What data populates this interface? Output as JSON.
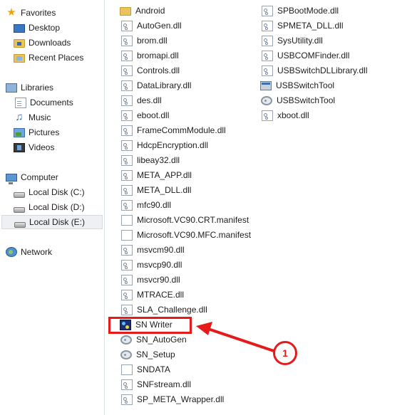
{
  "navigation": {
    "favorites": {
      "label": "Favorites",
      "icon": "star-icon",
      "items": [
        {
          "label": "Desktop",
          "icon": "desktop-icon"
        },
        {
          "label": "Downloads",
          "icon": "downloads-folder-icon"
        },
        {
          "label": "Recent Places",
          "icon": "recent-places-icon"
        }
      ]
    },
    "libraries": {
      "label": "Libraries",
      "icon": "libraries-icon",
      "items": [
        {
          "label": "Documents",
          "icon": "documents-icon"
        },
        {
          "label": "Music",
          "icon": "music-icon"
        },
        {
          "label": "Pictures",
          "icon": "pictures-icon"
        },
        {
          "label": "Videos",
          "icon": "videos-icon"
        }
      ]
    },
    "computer": {
      "label": "Computer",
      "icon": "computer-icon",
      "items": [
        {
          "label": "Local Disk (C:)",
          "icon": "disk-icon"
        },
        {
          "label": "Local Disk (D:)",
          "icon": "disk-icon"
        },
        {
          "label": "Local Disk (E:)",
          "icon": "disk-icon",
          "selected": true
        }
      ]
    },
    "network": {
      "label": "Network",
      "icon": "network-icon"
    }
  },
  "files": {
    "column1": [
      {
        "name": "Android",
        "type": "folder"
      },
      {
        "name": "AutoGen.dll",
        "type": "dll"
      },
      {
        "name": "brom.dll",
        "type": "dll"
      },
      {
        "name": "bromapi.dll",
        "type": "dll"
      },
      {
        "name": "Controls.dll",
        "type": "dll"
      },
      {
        "name": "DataLibrary.dll",
        "type": "dll"
      },
      {
        "name": "des.dll",
        "type": "dll"
      },
      {
        "name": "eboot.dll",
        "type": "dll"
      },
      {
        "name": "FrameCommModule.dll",
        "type": "dll"
      },
      {
        "name": "HdcpEncryption.dll",
        "type": "dll"
      },
      {
        "name": "libeay32.dll",
        "type": "dll"
      },
      {
        "name": "META_APP.dll",
        "type": "dll"
      },
      {
        "name": "META_DLL.dll",
        "type": "dll"
      },
      {
        "name": "mfc90.dll",
        "type": "dll"
      },
      {
        "name": "Microsoft.VC90.CRT.manifest",
        "type": "blank"
      },
      {
        "name": "Microsoft.VC90.MFC.manifest",
        "type": "blank"
      },
      {
        "name": "msvcm90.dll",
        "type": "dll"
      },
      {
        "name": "msvcp90.dll",
        "type": "dll"
      },
      {
        "name": "msvcr90.dll",
        "type": "dll"
      },
      {
        "name": "MTRACE.dll",
        "type": "dll"
      },
      {
        "name": "SLA_Challenge.dll",
        "type": "dll"
      },
      {
        "name": "SN Writer",
        "type": "snwriter"
      },
      {
        "name": "SN_AutoGen",
        "type": "gear"
      },
      {
        "name": "SN_Setup",
        "type": "gear"
      },
      {
        "name": "SNDATA",
        "type": "blank"
      },
      {
        "name": "SNFstream.dll",
        "type": "dll"
      },
      {
        "name": "SP_META_Wrapper.dll",
        "type": "dll"
      }
    ],
    "column2": [
      {
        "name": "SPBootMode.dll",
        "type": "dll"
      },
      {
        "name": "SPMETA_DLL.dll",
        "type": "dll"
      },
      {
        "name": "SysUtility.dll",
        "type": "dll"
      },
      {
        "name": "USBCOMFinder.dll",
        "type": "dll"
      },
      {
        "name": "USBSwitchDLLibrary.dll",
        "type": "dll"
      },
      {
        "name": "USBSwitchTool",
        "type": "exe"
      },
      {
        "name": "USBSwitchTool",
        "type": "gear"
      },
      {
        "name": "xboot.dll",
        "type": "dll"
      }
    ]
  },
  "annotation": {
    "badge_number": "1",
    "highlighted_file": "SN Writer",
    "color": "#e51a1a"
  }
}
